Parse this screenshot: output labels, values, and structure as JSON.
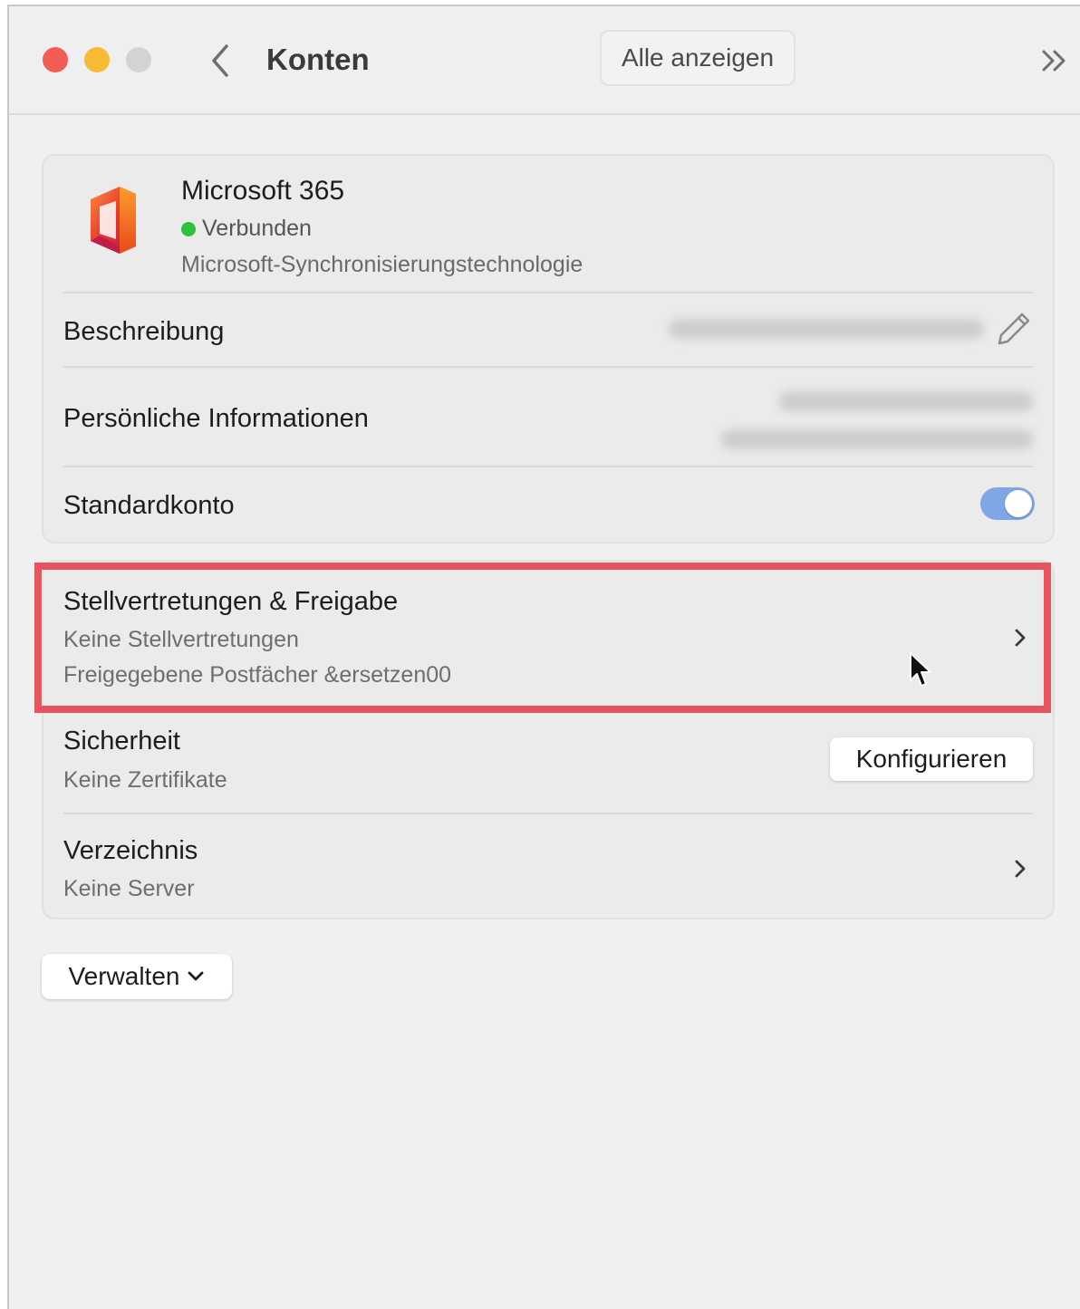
{
  "window": {
    "title": "Konten",
    "show_all_label": "Alle anzeigen"
  },
  "account": {
    "name": "Microsoft 365",
    "status": "Verbunden",
    "technology": "Microsoft-Synchronisierungstechnologie"
  },
  "settings": {
    "description_label": "Beschreibung",
    "personal_info_label": "Persönliche Informationen",
    "default_account_label": "Standardkonto",
    "default_account_on": true
  },
  "delegation": {
    "title": "Stellvertretungen & Freigabe",
    "delegates": "Keine Stellvertretungen",
    "shared_mailboxes": "Freigegebene Postfächer &ersetzen00"
  },
  "security": {
    "title": "Sicherheit",
    "subtitle": "Keine Zertifikate",
    "configure_label": "Konfigurieren"
  },
  "directory": {
    "title": "Verzeichnis",
    "subtitle": "Keine Server"
  },
  "footer": {
    "manage_label": "Verwalten"
  },
  "colors": {
    "highlight": "#e8545d",
    "toggle_on": "#7fa6e6",
    "status_connected": "#2ec140"
  },
  "icons": [
    "back-icon",
    "double-chevron-icon",
    "office-logo-icon",
    "pencil-icon",
    "chevron-right-icon",
    "chevron-down-icon",
    "mouse-cursor-icon"
  ]
}
